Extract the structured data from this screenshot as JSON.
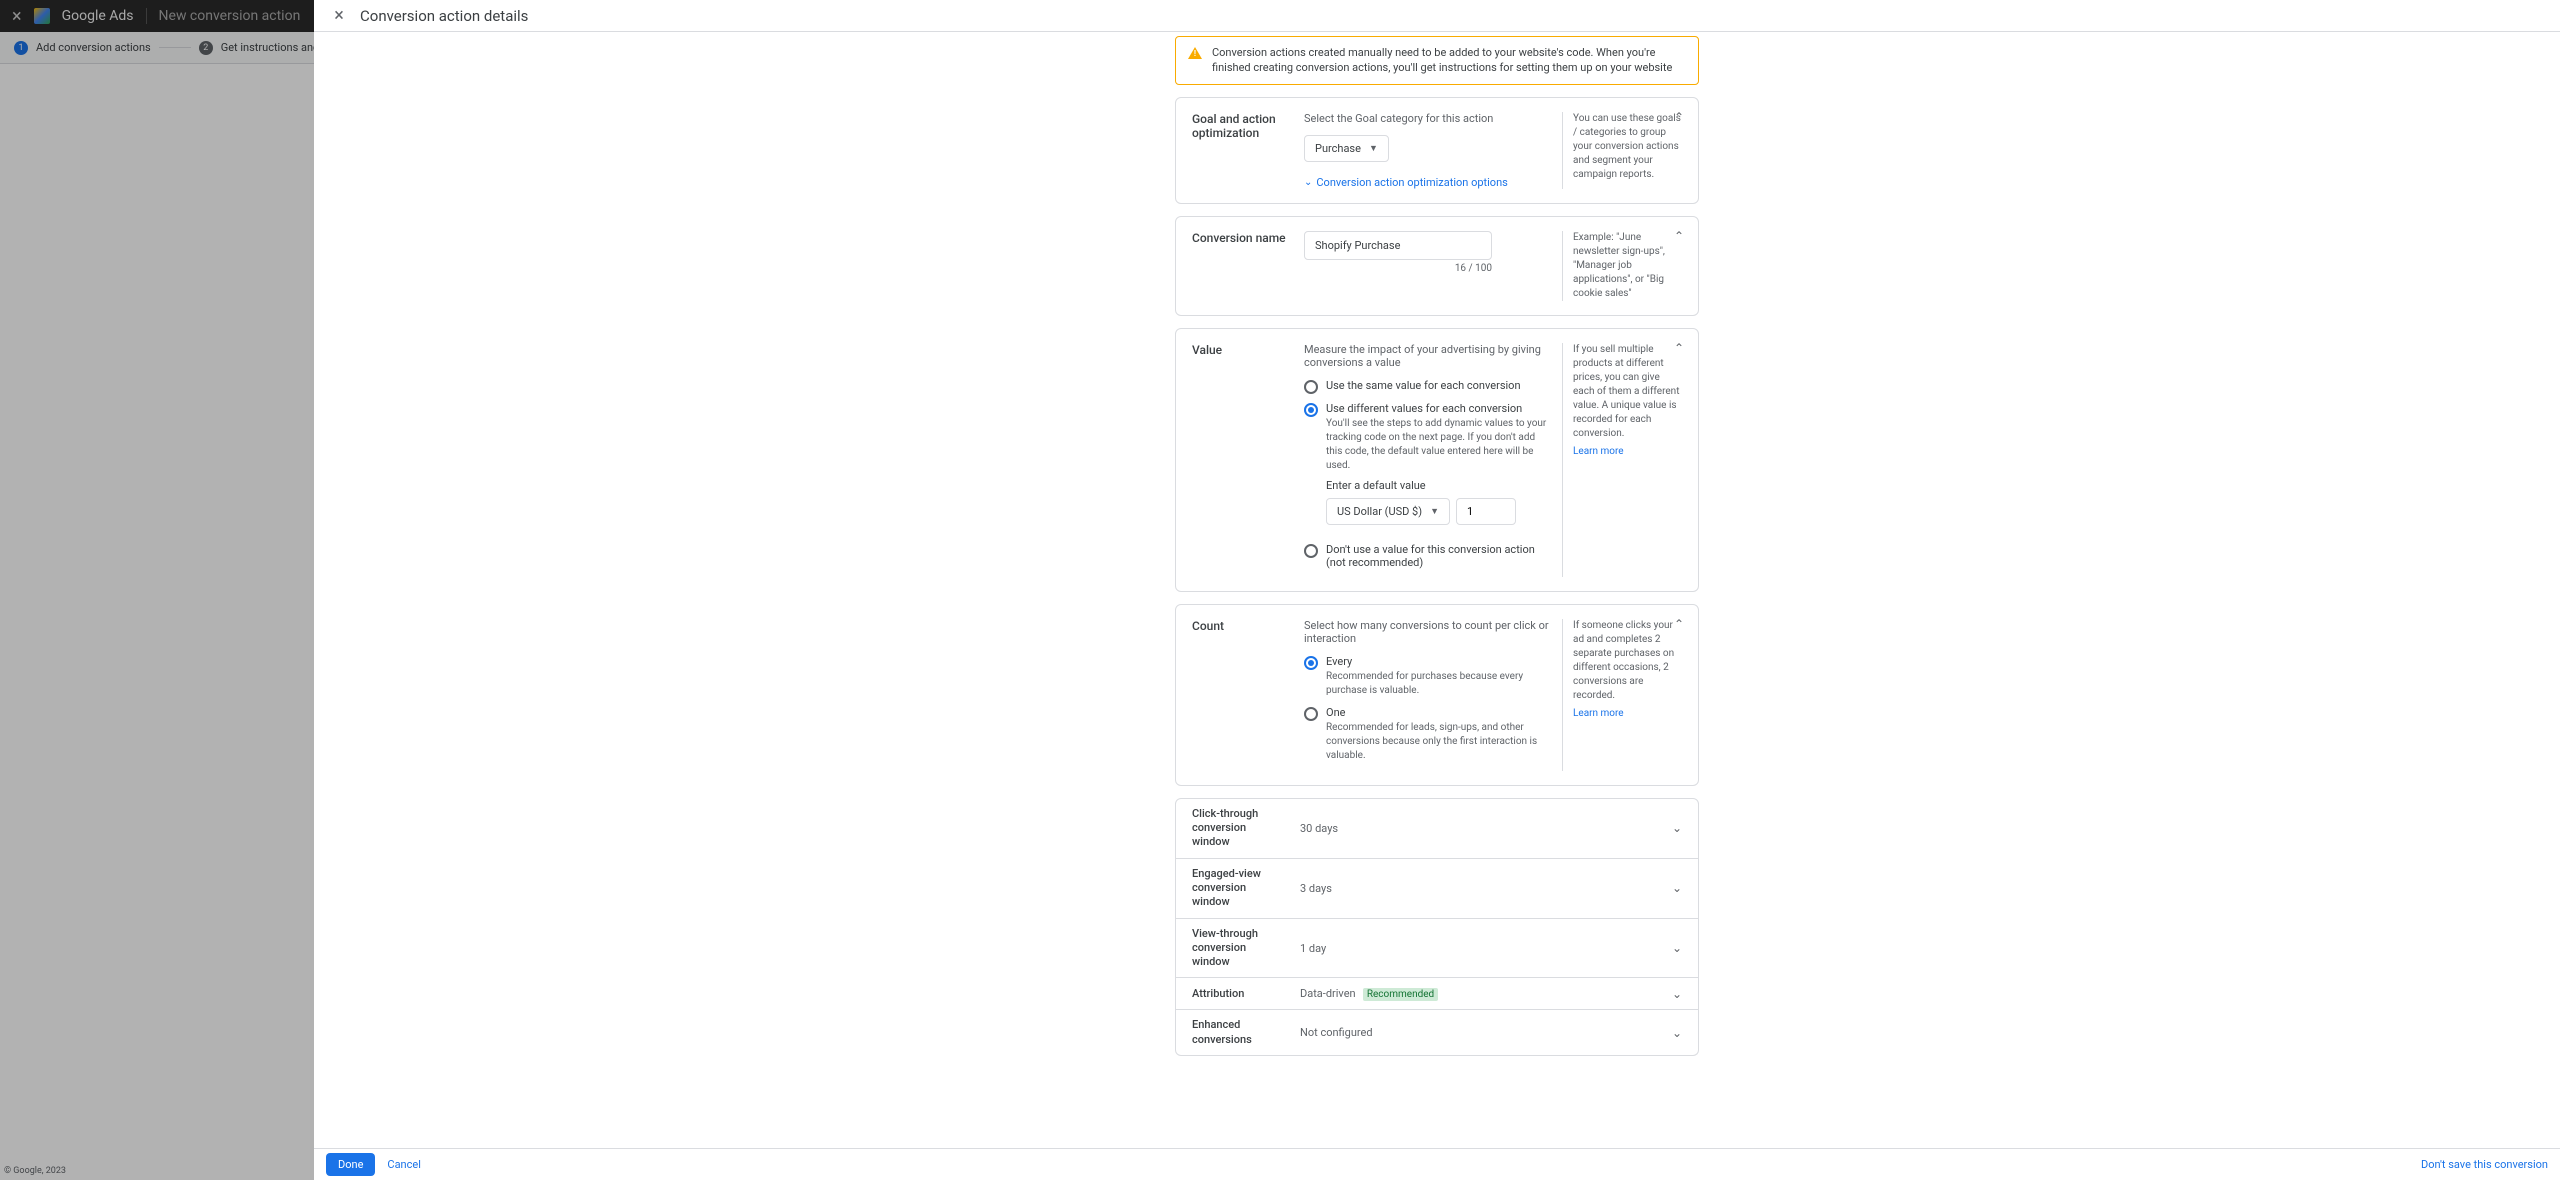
{
  "bg": {
    "brand": "Google Ads",
    "page_title": "New conversion action",
    "step1": "Add conversion actions",
    "step2": "Get instructions and finish"
  },
  "modal": {
    "title": "Conversion action details"
  },
  "warning": "Conversion actions created manually need to be added to your website's code. When you're finished creating conversion actions, you'll get instructions for setting them up on your website",
  "goal": {
    "label": "Goal and action optimization",
    "hint": "Select the Goal category for this action",
    "value": "Purchase",
    "expand_link": "Conversion action optimization options",
    "help": "You can use these goals / categories to group your conversion actions and segment your campaign reports."
  },
  "name": {
    "label": "Conversion name",
    "value": "Shopify Purchase",
    "count": "16 / 100",
    "help": "Example: \"June newsletter sign-ups\", \"Manager job applications\", or \"Big cookie sales\""
  },
  "value": {
    "label": "Value",
    "hint": "Measure the impact of your advertising by giving conversions a value",
    "opt_same": "Use the same value for each conversion",
    "opt_diff": "Use different values for each conversion",
    "opt_diff_sub": "You'll see the steps to add dynamic values to your tracking code on the next page. If you don't add this code, the default value entered here will be used.",
    "default_label": "Enter a default value",
    "currency": "US Dollar (USD $)",
    "default_value": "1",
    "opt_none": "Don't use a value for this conversion action (not recommended)",
    "help": "If you sell multiple products at different prices, you can give each of them a different value. A unique value is recorded for each conversion.",
    "learn_more": "Learn more"
  },
  "count": {
    "label": "Count",
    "hint": "Select how many conversions to count per click or interaction",
    "opt_every": "Every",
    "opt_every_sub": "Recommended for purchases because every purchase is valuable.",
    "opt_one": "One",
    "opt_one_sub": "Recommended for leads, sign-ups, and other conversions because only the first interaction is valuable.",
    "help": "If someone clicks your ad and completes 2 separate purchases on different occasions, 2 conversions are recorded.",
    "learn_more": "Learn more"
  },
  "collapsed": {
    "click_window": {
      "label": "Click-through conversion window",
      "value": "30 days"
    },
    "engaged_window": {
      "label": "Engaged-view conversion window",
      "value": "3 days"
    },
    "view_window": {
      "label": "View-through conversion window",
      "value": "1 day"
    },
    "attribution": {
      "label": "Attribution",
      "value": "Data-driven",
      "badge": "Recommended"
    },
    "enhanced": {
      "label": "Enhanced conversions",
      "value": "Not configured"
    }
  },
  "footer": {
    "done": "Done",
    "cancel": "Cancel",
    "dont_save": "Don't save this conversion"
  },
  "copyright": "© Google, 2023"
}
